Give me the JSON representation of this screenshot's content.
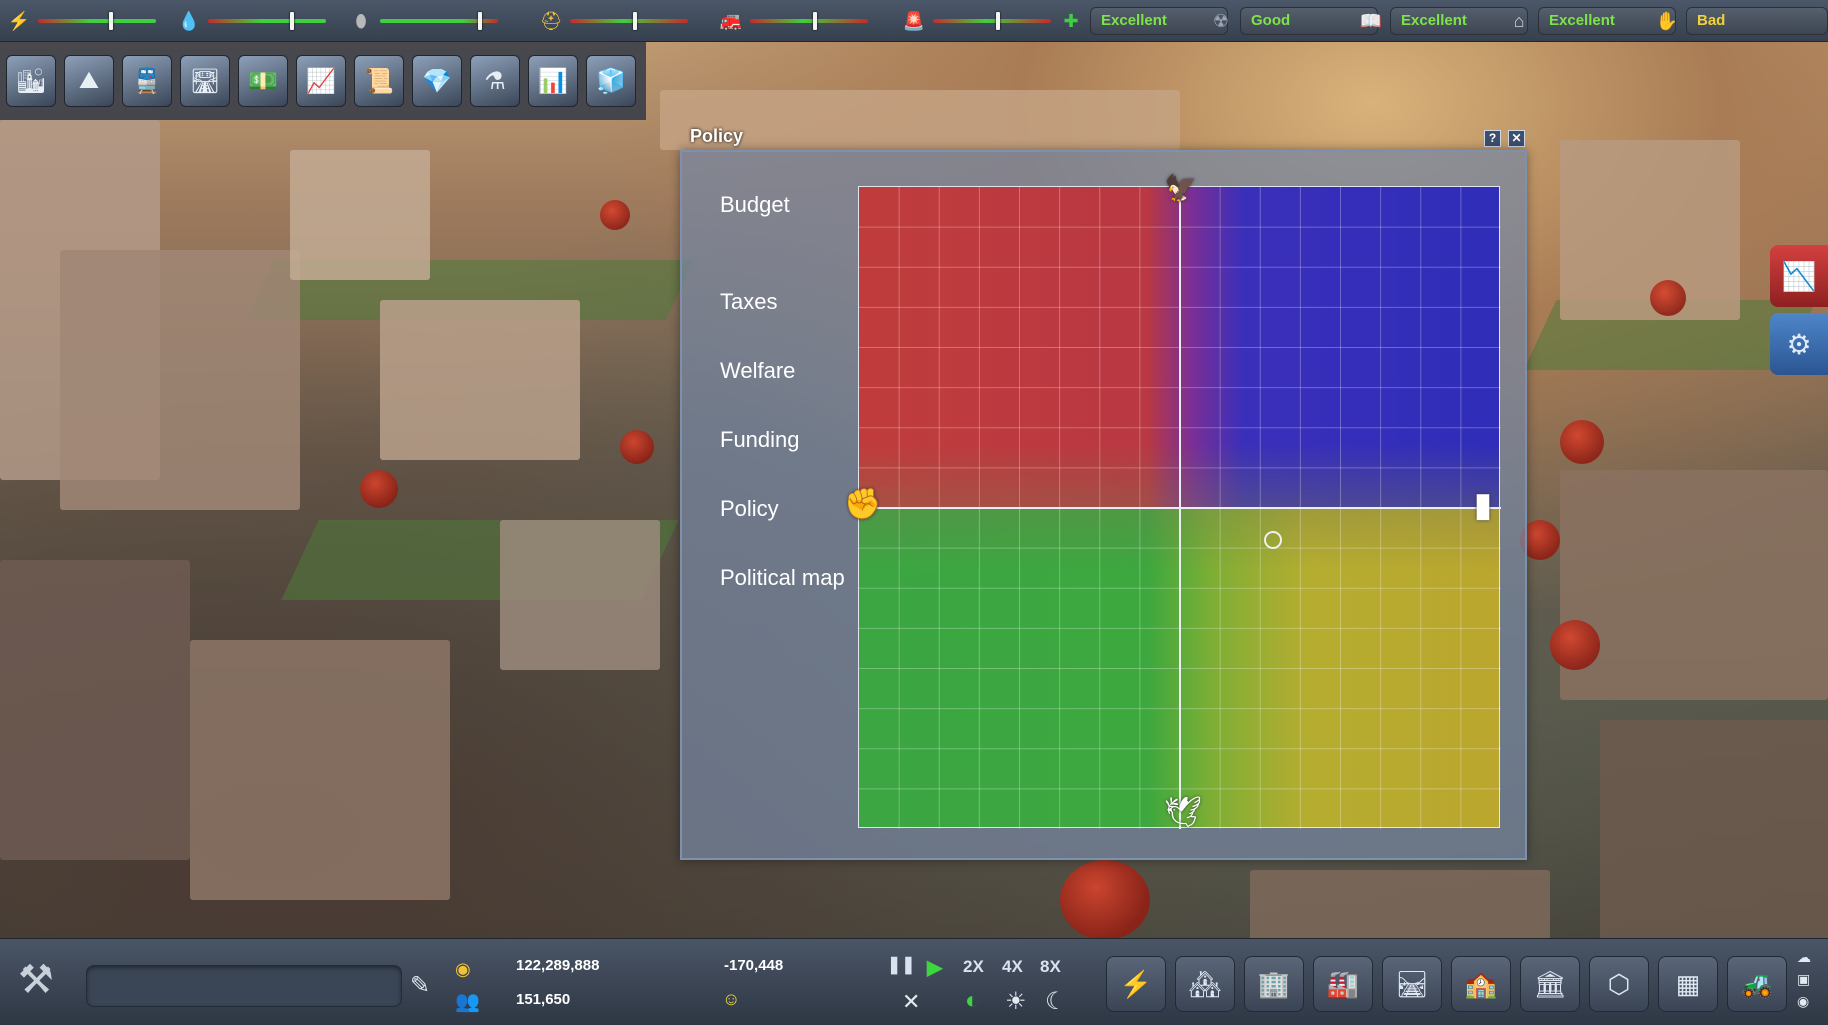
{
  "topbar": {
    "indicators": [
      {
        "icon": "power-icon",
        "glyph": "⚡",
        "color": "#f0d23a",
        "level": 0.62
      },
      {
        "icon": "water-drop-icon",
        "glyph": "💧",
        "color": "#5bb6f0",
        "level": 0.72
      },
      {
        "icon": "sewage-icon",
        "glyph": "⬮",
        "color": "#b8b8b8",
        "level": 0.86
      },
      {
        "icon": "police-icon",
        "glyph": "⛑",
        "color": "#f2c23b",
        "level": 0.55
      },
      {
        "icon": "fire-icon",
        "glyph": "🚒",
        "color": "#c8d4e6",
        "level": 0.55
      },
      {
        "icon": "crime-icon",
        "glyph": "🚨",
        "color": "#c8d4e6",
        "level": 0.55
      }
    ],
    "ratings": [
      {
        "icon": "health-cross-icon",
        "glyph": "✚",
        "color": "#3ecf3e",
        "label": "Excellent"
      },
      {
        "icon": "environment-icon",
        "glyph": "☢",
        "color": "#9aa6b5",
        "label": "Good"
      },
      {
        "icon": "education-book-icon",
        "glyph": "📖",
        "color": "#c8d4e6",
        "label": "Excellent"
      },
      {
        "icon": "housing-icon",
        "glyph": "⌂",
        "color": "#c8d4e6",
        "label": "Excellent"
      },
      {
        "icon": "happiness-icon",
        "glyph": "✋",
        "color": "#e05050",
        "label": "Bad"
      }
    ]
  },
  "toolstrip": [
    {
      "name": "city-overview-icon",
      "glyph": "🏙"
    },
    {
      "name": "terrain-icon",
      "glyph": "⛰"
    },
    {
      "name": "transport-icon",
      "glyph": "🚆"
    },
    {
      "name": "roads-icon",
      "glyph": "🛣"
    },
    {
      "name": "money-icon",
      "glyph": "💵"
    },
    {
      "name": "graphs-icon",
      "glyph": "📈"
    },
    {
      "name": "documents-icon",
      "glyph": "📜"
    },
    {
      "name": "resources-icon",
      "glyph": "💎"
    },
    {
      "name": "research-flask-icon",
      "glyph": "⚗"
    },
    {
      "name": "statistics-icon",
      "glyph": "📊"
    },
    {
      "name": "buildings-3d-icon",
      "glyph": "🧊"
    }
  ],
  "policy_window": {
    "title": "Policy",
    "help_label": "?",
    "close_label": "✕",
    "menu": [
      "Budget",
      "Taxes",
      "Welfare",
      "Funding",
      "Policy",
      "Political map"
    ],
    "map": {
      "colors": {
        "top_left": "#c03c3c",
        "top_right": "#2f2db9",
        "bottom_left": "#3ba642",
        "bottom_right": "#bba62e"
      },
      "position": {
        "x": 0.29,
        "y": -0.1
      },
      "top_icon": "eagle-icon",
      "bottom_icon": "dove-icon",
      "left_icon": "raised-fist-icon",
      "right_icon": "money-scroll-icon"
    }
  },
  "side_buttons": [
    {
      "name": "trend-graph-icon",
      "glyph": "📉"
    },
    {
      "name": "settings-gear-icon",
      "glyph": "⚙"
    }
  ],
  "bottombar": {
    "money": "122,289,888",
    "population": "151,650",
    "income": "-170,448",
    "mood": "☺",
    "speed": {
      "pause": "❚❚",
      "play": "▶",
      "x2": "2X",
      "x4": "4X",
      "x8": "8X"
    },
    "city_name": "",
    "categories": [
      {
        "name": "utilities-icon",
        "glyph": "⚡"
      },
      {
        "name": "residential-icon",
        "glyph": "🏘"
      },
      {
        "name": "commercial-icon",
        "glyph": "🏢"
      },
      {
        "name": "industrial-icon",
        "glyph": "🏭"
      },
      {
        "name": "transport-road-icon",
        "glyph": "🛤"
      },
      {
        "name": "services-icon",
        "glyph": "🏫"
      },
      {
        "name": "government-icon",
        "glyph": "🏛"
      },
      {
        "name": "landmarks-icon",
        "glyph": "⬡"
      },
      {
        "name": "zones-icon",
        "glyph": "▦"
      },
      {
        "name": "bulldozer-icon",
        "glyph": "🚜"
      }
    ]
  }
}
